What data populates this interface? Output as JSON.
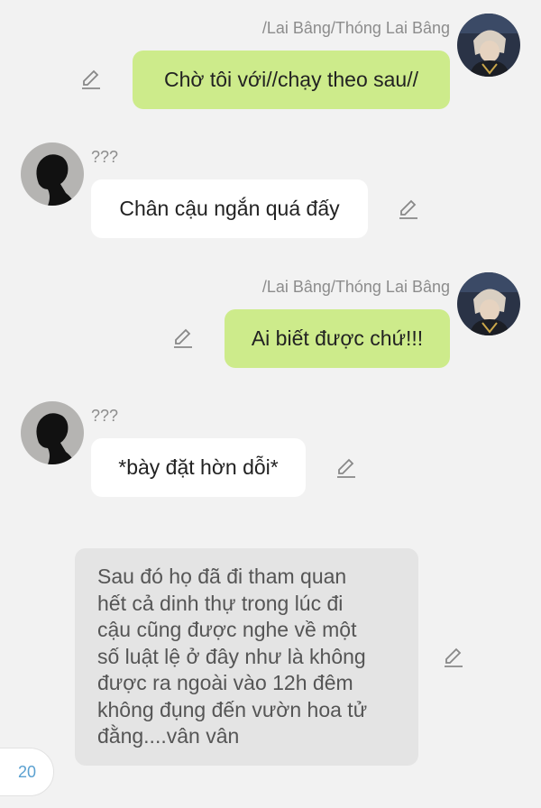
{
  "messages": [
    {
      "speaker": "/Lai Bâng/Thóng Lai Bâng",
      "text": "Chờ tôi với//chạy theo sau//",
      "side": "right"
    },
    {
      "speaker": "???",
      "text": "Chân cậu ngắn quá đấy",
      "side": "left"
    },
    {
      "speaker": "/Lai Bâng/Thóng Lai Bâng",
      "text": "Ai biết được chứ!!!",
      "side": "right"
    },
    {
      "speaker": "???",
      "text": "*bày đặt hờn dỗi*",
      "side": "left"
    }
  ],
  "narration": "Sau đó họ đã đi tham quan\nhết cả dinh thự trong lúc đi\ncậu cũng được nghe về một\nsố luật lệ ở đây như là không\nđược ra ngoài vào 12h đêm\nkhông đụng đến vườn hoa tử\nđằng....vân vân",
  "page_number": "20",
  "colors": {
    "right_bubble": "#cdeb8b",
    "left_bubble": "#ffffff",
    "narration_bg": "#e4e4e4",
    "background": "#f2f2f2",
    "page_number": "#5aa0d0"
  },
  "icons": {
    "edit": "pencil-edit-icon",
    "right_avatar": "character-avatar",
    "left_avatar": "silhouette-avatar"
  }
}
